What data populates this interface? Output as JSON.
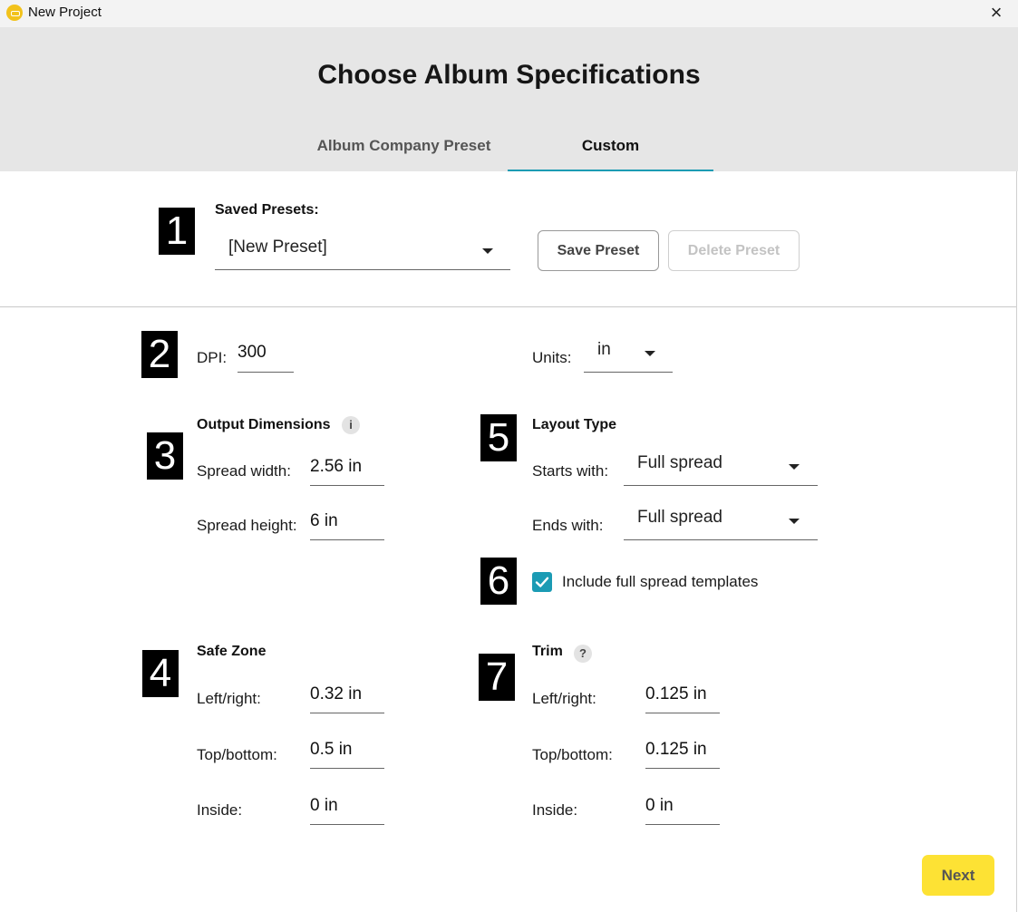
{
  "window": {
    "title": "New Project",
    "close_icon": "×"
  },
  "header": {
    "title": "Choose Album Specifications"
  },
  "tabs": [
    {
      "label": "Album Company Preset",
      "selected": false
    },
    {
      "label": "Custom",
      "selected": true
    }
  ],
  "badges": [
    "1",
    "2",
    "3",
    "4",
    "5",
    "6",
    "7"
  ],
  "presets": {
    "label": "Saved Presets:",
    "selected": "[New Preset]",
    "save_label": "Save Preset",
    "delete_label": "Delete Preset"
  },
  "dpi": {
    "label": "DPI:",
    "value": "300"
  },
  "units": {
    "label": "Units:",
    "value": "in"
  },
  "output": {
    "title": "Output Dimensions",
    "info_icon": "i",
    "width_label": "Spread width:",
    "width_value": "2.56 in",
    "height_label": "Spread height:",
    "height_value": "6 in"
  },
  "layout": {
    "title": "Layout Type",
    "starts_label": "Starts with:",
    "starts_value": "Full spread",
    "ends_label": "Ends with:",
    "ends_value": "Full spread"
  },
  "templates": {
    "label": "Include full spread templates",
    "checked": true
  },
  "safe_zone": {
    "title": "Safe Zone",
    "lr_label": "Left/right:",
    "lr_value": "0.32 in",
    "tb_label": "Top/bottom:",
    "tb_value": "0.5 in",
    "inside_label": "Inside:",
    "inside_value": "0 in"
  },
  "trim": {
    "title": "Trim",
    "help_icon": "?",
    "lr_label": "Left/right:",
    "lr_value": "0.125 in",
    "tb_label": "Top/bottom:",
    "tb_value": "0.125 in",
    "inside_label": "Inside:",
    "inside_value": "0 in"
  },
  "footer": {
    "next_label": "Next"
  },
  "colors": {
    "accent": "#1b9bb4",
    "next_button": "#fde234",
    "header_bg": "#e6e6e6"
  }
}
